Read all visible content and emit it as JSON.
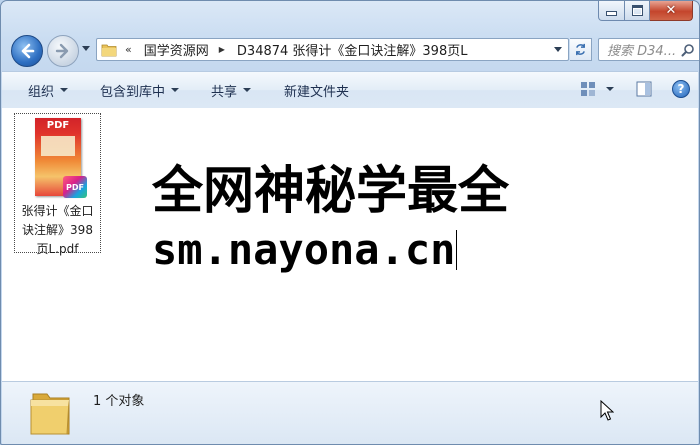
{
  "window": {
    "caption_buttons": [
      "minimize",
      "maximize",
      "close"
    ]
  },
  "nav": {
    "address": {
      "overflow_chevron": "«",
      "crumbs": [
        "国学资源网",
        "D34874 张得计《金口诀注解》398页L"
      ]
    },
    "search_placeholder": "搜索 D34..."
  },
  "toolbar": {
    "organize": "组织",
    "include_in_library": "包含到库中",
    "share": "共享",
    "new_folder": "新建文件夹",
    "help": "?"
  },
  "content": {
    "file": {
      "name": "张得计《金口诀注解》398页L.pdf",
      "thumb_label": "PDF",
      "badge_label": "PDF"
    },
    "watermark": {
      "line1": "全网神秘学最全",
      "line2": "sm.nayona.cn"
    }
  },
  "details": {
    "count_text": "1 个对象"
  },
  "colors": {
    "accent": "#2e6fc2",
    "close_button": "#c4452c",
    "window_frame": "#c3d7ee"
  }
}
